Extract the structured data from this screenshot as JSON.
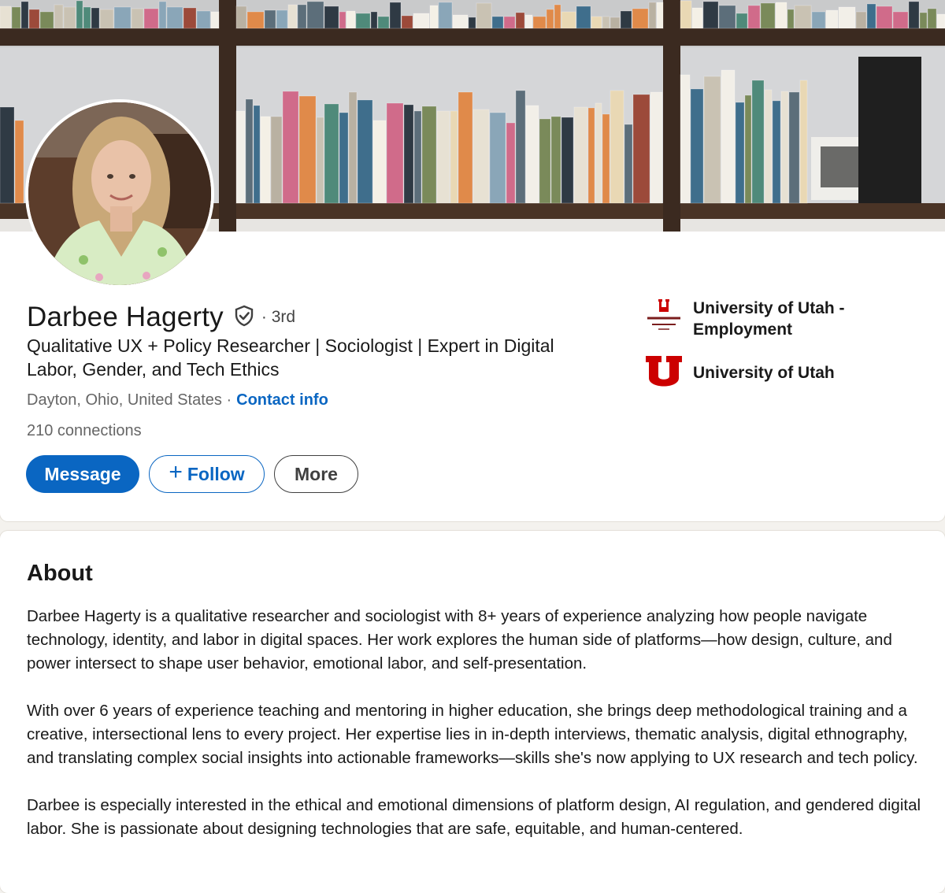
{
  "profile": {
    "name": "Darbee Hagerty",
    "degree": "· 3rd",
    "headline": "Qualitative UX + Policy Researcher | Sociologist | Expert in Digital Labor, Gender, and Tech Ethics",
    "location": "Dayton, Ohio, United States ·",
    "contact_info": "Contact info",
    "connections": "210 connections",
    "icons": {
      "verified": "verified-shield-icon",
      "follow": "plus-icon"
    }
  },
  "actions": {
    "message": "Message",
    "follow": "Follow",
    "more": "More"
  },
  "organizations": [
    {
      "name": "University of Utah - Employment",
      "logo": "university-of-utah-wordmark-logo"
    },
    {
      "name": "University of Utah",
      "logo": "university-of-utah-u-logo"
    }
  ],
  "about": {
    "title": "About",
    "paragraphs": [
      "Darbee Hagerty is a qualitative researcher and sociologist with 8+ years of experience analyzing how people navigate technology, identity, and labor in digital spaces. Her work explores the human side of platforms—how design, culture, and power intersect to shape user behavior, emotional labor, and self-presentation.",
      "With over 6 years of experience teaching and mentoring in higher education, she brings deep methodological training and a creative, intersectional lens to every project. Her expertise lies in in-depth interviews, thematic analysis, digital ethnography, and translating complex social insights into actionable frameworks—skills she's now applying to UX research and tech policy.",
      "Darbee is especially interested in the ethical and emotional dimensions of platform design, AI regulation, and gendered digital labor. She is passionate about designing technologies that are safe, equitable, and human-centered."
    ]
  },
  "colors": {
    "accent": "#0a66c2",
    "utah_red": "#cc0000",
    "page_bg": "#f4f2ee"
  }
}
